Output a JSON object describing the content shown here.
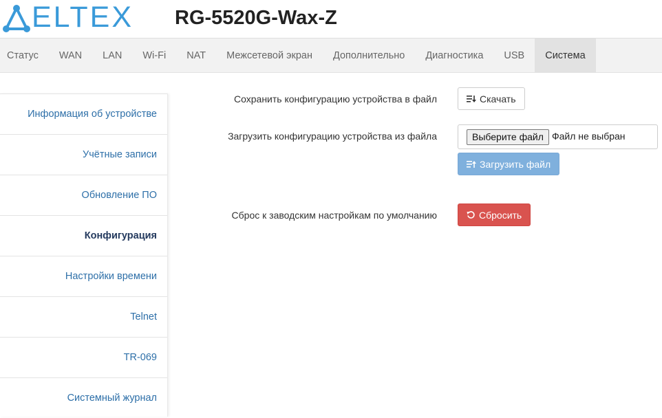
{
  "header": {
    "logo_text": "ELTEX",
    "model": "RG-5520G-Wax-Z"
  },
  "nav": {
    "items": [
      {
        "label": "Статус"
      },
      {
        "label": "WAN"
      },
      {
        "label": "LAN"
      },
      {
        "label": "Wi-Fi"
      },
      {
        "label": "NAT"
      },
      {
        "label": "Межсетевой экран"
      },
      {
        "label": "Дополнительно"
      },
      {
        "label": "Диагностика"
      },
      {
        "label": "USB"
      },
      {
        "label": "Система"
      }
    ],
    "active": "Система"
  },
  "sidebar": {
    "items": [
      {
        "label": "Информация об устройстве"
      },
      {
        "label": "Учётные записи"
      },
      {
        "label": "Обновление ПО"
      },
      {
        "label": "Конфигурация"
      },
      {
        "label": "Настройки времени"
      },
      {
        "label": "Telnet"
      },
      {
        "label": "TR-069"
      },
      {
        "label": "Системный журнал"
      }
    ],
    "active": "Конфигурация"
  },
  "config": {
    "save_label": "Сохранить конфигурацию устройства в файл",
    "download_button": "Скачать",
    "load_label": "Загрузить конфигурацию устройства из файла",
    "choose_file_button": "Выберите файл",
    "file_status": "Файл не выбран",
    "upload_button": "Загрузить файл",
    "reset_label": "Сброс к заводским настройкам по умолчанию",
    "reset_button": "Сбросить"
  },
  "colors": {
    "brand": "#3a9ad9",
    "link": "#2d6fa8",
    "primary_disabled": "#7fb0dd",
    "danger": "#d9534f"
  }
}
